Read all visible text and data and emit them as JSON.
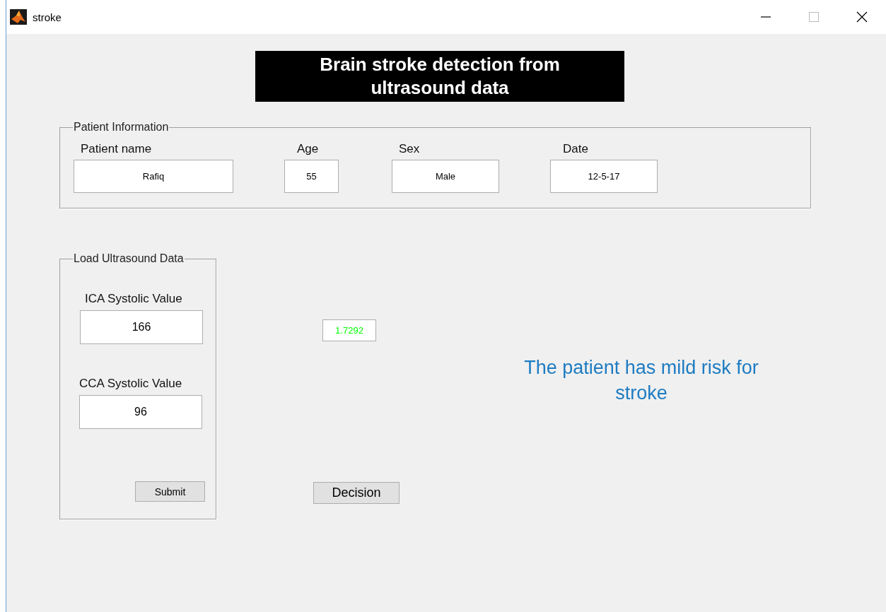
{
  "window": {
    "title": "stroke"
  },
  "banner": "Brain stroke detection from ultrasound data",
  "patient_panel": {
    "title": "Patient Information",
    "fields": [
      {
        "label": "Patient name",
        "value": "Rafiq"
      },
      {
        "label": "Age",
        "value": "55"
      },
      {
        "label": "Sex",
        "value": "Male"
      },
      {
        "label": "Date",
        "value": "12-5-17"
      }
    ]
  },
  "ultrasound_panel": {
    "title": "Load Ultrasound Data",
    "fields": [
      {
        "label": "ICA Systolic Value",
        "value": "166"
      },
      {
        "label": "CCA Systolic Value",
        "value": "96"
      }
    ],
    "submit_button": "Submit"
  },
  "ratio_value": "1.7292",
  "decision_button": "Decision",
  "result": "The patient has mild risk for stroke"
}
